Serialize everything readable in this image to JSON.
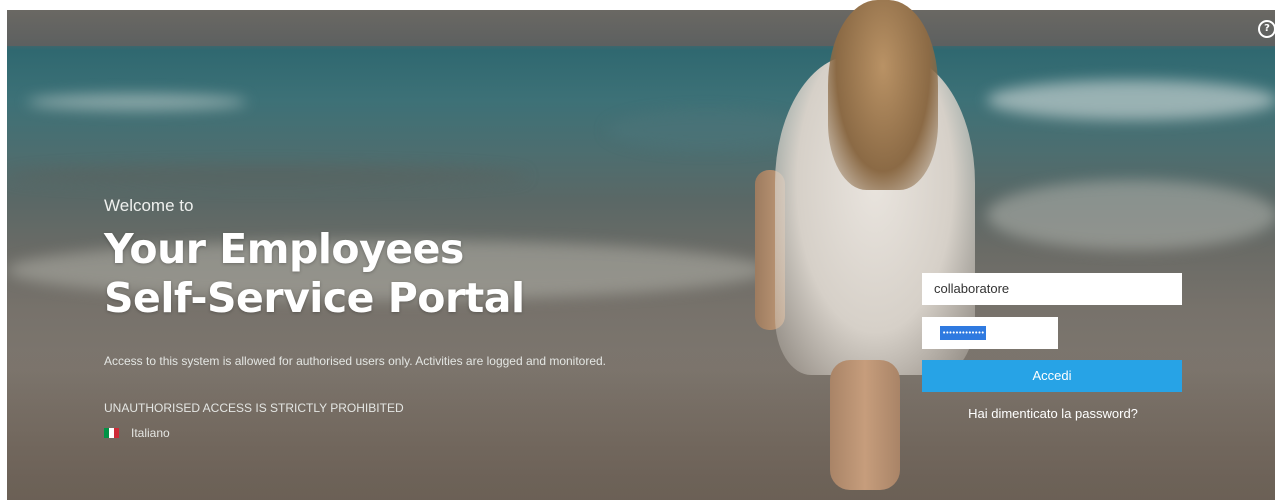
{
  "hero": {
    "welcome": "Welcome to",
    "title_line1": "Your Employees",
    "title_line2": "Self-Service Portal",
    "notice": "Access to this system is allowed for authorised users only. Activities are logged and monitored.",
    "warning": "UNAUTHORISED ACCESS IS STRICTLY PROHIBITED",
    "language": "Italiano",
    "flag_colors": [
      "#009246",
      "#ffffff",
      "#ce2b37"
    ]
  },
  "login": {
    "username_value": "collaboratore",
    "password_mask": "•••••••••••••",
    "submit_label": "Accedi",
    "forgot_label": "Hai dimenticato la password?",
    "button_color": "#27a3e6"
  },
  "icons": {
    "help": "help-circle-icon",
    "flag": "italy-flag-icon"
  },
  "help_glyph": "?"
}
